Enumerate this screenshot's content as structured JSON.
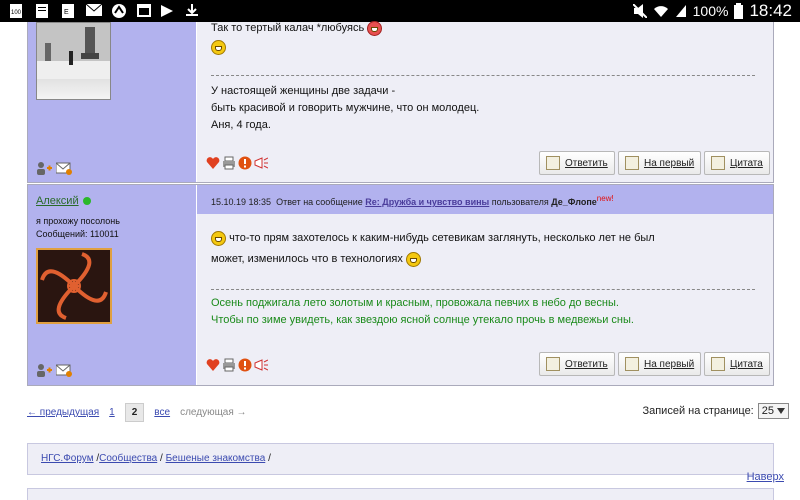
{
  "statusbar": {
    "battery_text": "100%",
    "time": "18:42"
  },
  "post1": {
    "line1": "Так то тертый калач *любуясь",
    "sig_lines": [
      "У настоящей женщины две задачи -",
      "быть красивой и говорить мужчине, что он молодец.",
      "Аня, 4 года."
    ]
  },
  "post2": {
    "username": "Алексий",
    "user_status": "я прохожу посолонь",
    "user_count": "Сообщений: 110011",
    "header": {
      "date": "15.10.19 18:35",
      "reply_text": "Ответ на сообщение",
      "reply_link": "Re: Дружба и чувство вины",
      "by_text": "пользователя",
      "by_user": "Де_Флопе",
      "new_tag": "new!"
    },
    "body_line1": "что-то прям захотелось к каким-нибудь сетевикам заглянуть, несколько лет не был",
    "body_line2": "может, изменилось что в технологиях",
    "sig_lines": [
      "Осень поджигала лето золотым и красным, провожала певчих в небо до весны.",
      "Чтобы по зиме увидеть, как звездою ясной солнце утекало прочь в медвежьи сны."
    ]
  },
  "buttons": {
    "reply": "Ответить",
    "first": "На первый",
    "quote": "Цитата"
  },
  "pagination": {
    "prev": "← предыдущая",
    "pages": [
      "1",
      "2"
    ],
    "current": "2",
    "all": "все",
    "next": "следующая →"
  },
  "perpage": {
    "label": "Записей на странице:",
    "value": "25"
  },
  "breadcrumb": {
    "items": [
      "НГС.Форум",
      "Сообщества",
      "Бешеные знакомства"
    ],
    "sep": "/"
  },
  "top_link": "Наверх",
  "colors": {
    "post_sidebar": "#b2b2ee",
    "post_body": "#eeeef6",
    "signature_green": "#1a8a1a",
    "link_blue": "#3b4ab0"
  },
  "icons": [
    "notification-icons",
    "wifi-icon",
    "mute-icon",
    "battery-icon",
    "heart-icon",
    "print-icon",
    "alert-icon",
    "megaphone-icon",
    "add-friend-icon",
    "message-icon"
  ]
}
